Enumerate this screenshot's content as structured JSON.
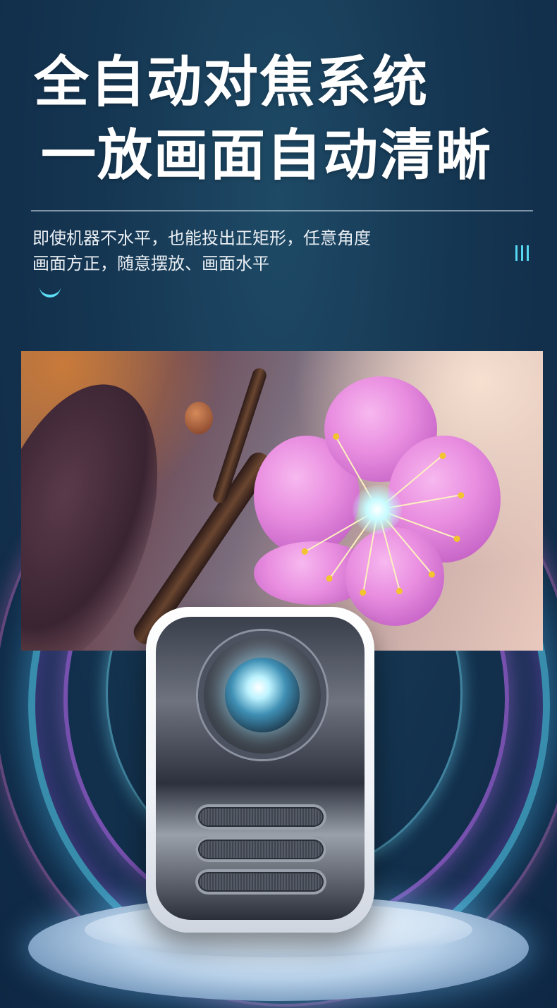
{
  "header": {
    "title_line1": "全自动对焦系统",
    "title_line2": "一放画面自动清晰",
    "subtitle_line1": "即使机器不水平，也能投出正矩形，任意角度",
    "subtitle_line2": "画面方正，随意摆放、画面水平"
  },
  "icons": {
    "bars": "vertical-bars-icon",
    "smile": "smile-arc-icon"
  },
  "colors": {
    "background": "#153652",
    "accent": "#56d6f0",
    "title_text": "#ffffff"
  }
}
